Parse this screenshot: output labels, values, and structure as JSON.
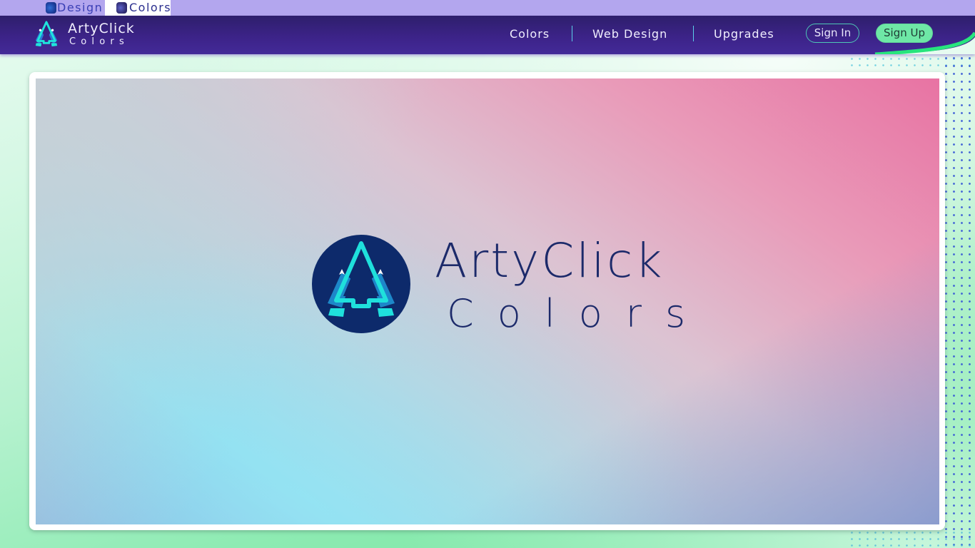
{
  "tabs": [
    {
      "label": "Design",
      "icon": "artyclick-tab-icon",
      "active": false
    },
    {
      "label": "Colors",
      "icon": "artyclick-tab-icon",
      "active": true
    }
  ],
  "header": {
    "brand_name": "ArtyClick",
    "brand_sub": "Colors",
    "nav": [
      {
        "label": "Colors"
      },
      {
        "label": "Web Design"
      },
      {
        "label": "Upgrades"
      }
    ],
    "signin_label": "Sign In",
    "signup_label": "Sign Up"
  },
  "hero": {
    "title": "ArtyClick",
    "subtitle": "Colors"
  },
  "colors": {
    "header_bg": "#3c2388",
    "tab_strip": "#b3a6ee",
    "signup_bg": "#6ee7a6",
    "accent_green": "#22e07a",
    "logo_navy": "#0d2a6b",
    "logo_cyan": "#1fe0dc",
    "gradient_pink": "#e873a3",
    "gradient_cyan": "#92dff0"
  }
}
